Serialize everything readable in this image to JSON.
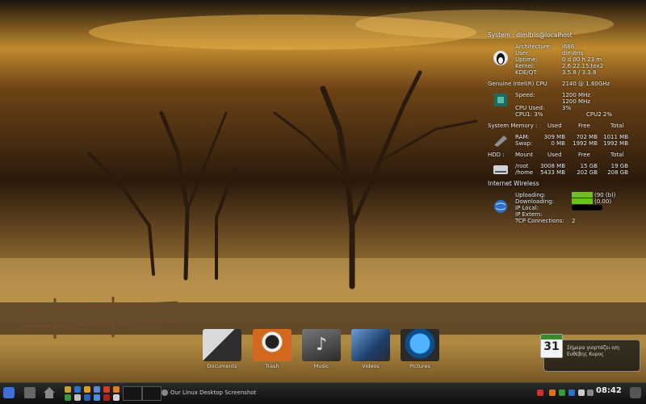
{
  "system": {
    "header": "System : dimitris@localhost",
    "rows": [
      {
        "label": "Architecture:",
        "value": "i686"
      },
      {
        "label": "User:",
        "value": "dimitris"
      },
      {
        "label": "Uptime:",
        "value": "0 d 00 h 23 m"
      },
      {
        "label": "Kernel:",
        "value": "2.6.22.15.tex2"
      },
      {
        "label": "KDE/QT:",
        "value": "3.5.8 / 3.3.8"
      }
    ]
  },
  "cpu": {
    "name": "Genuine Intel(R) CPU",
    "freq": "2140  @ 1.60GHz",
    "speed_label": "Speed:",
    "speed_1": "1200 MHz",
    "speed_2": "1200 MHz",
    "used_label": "CPU Used:",
    "used": "3%",
    "cpu1": "CPU1:  3%",
    "cpu2": "CPU2  2%"
  },
  "memory": {
    "header": "System Memory :",
    "cols": [
      "Used",
      "Free",
      "Total"
    ],
    "rows": [
      {
        "label": "RAM:",
        "used": "309 MB",
        "free": "702 MB",
        "total": "1011 MB"
      },
      {
        "label": "Swap:",
        "used": "0 MB",
        "free": "1992 MB",
        "total": "1992 MB"
      }
    ]
  },
  "hdd": {
    "header": "HDD :",
    "cols": [
      "Mount",
      "Used",
      "Free",
      "Total"
    ],
    "rows": [
      {
        "mount": "/root",
        "used": "3008 MB",
        "free": "15 GB",
        "total": "19 GB"
      },
      {
        "mount": "/home",
        "used": "5433 MB",
        "free": "202 GB",
        "total": "208 GB"
      }
    ]
  },
  "internet": {
    "header": "Internet Wireless",
    "rows": [
      {
        "label": "Uploading:",
        "value": "(90 (b))"
      },
      {
        "label": "Downloading:",
        "value": "(0.00)"
      },
      {
        "label": "IP Local:",
        "value": ""
      },
      {
        "label": "IP Extern:",
        "value": ""
      },
      {
        "label": "TCP Connections:",
        "value": "2"
      }
    ]
  },
  "dock": [
    {
      "label": "Documents",
      "icon": "documents-folder-icon",
      "color": "#3a3a3a"
    },
    {
      "label": "Trash",
      "icon": "trash-icon",
      "color": "#c75a1c"
    },
    {
      "label": "Music",
      "icon": "music-folder-icon",
      "color": "#444"
    },
    {
      "label": "Videos",
      "icon": "videos-folder-icon",
      "color": "#2c5d8a"
    },
    {
      "label": "Pictures",
      "icon": "pictures-folder-icon",
      "color": "#1d78b8"
    }
  ],
  "calendar": {
    "day": "31",
    "text": "Σήμερα γιορτάζει ο/η Ευθέβης Κυρος"
  },
  "taskbar": {
    "task": "Our Linux Desktop Screenshot",
    "clock": "08:42"
  }
}
